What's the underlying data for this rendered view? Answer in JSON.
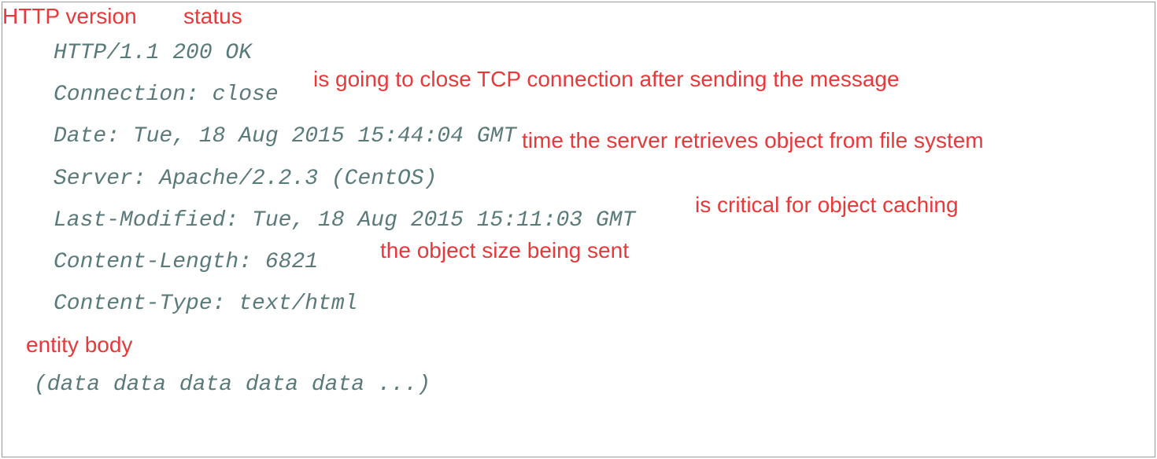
{
  "http": {
    "statusLine": "HTTP/1.1 200 OK",
    "connection": "Connection: close",
    "date": "Date: Tue, 18 Aug 2015 15:44:04 GMT",
    "server": "Server: Apache/2.2.3 (CentOS)",
    "lastModified": "Last-Modified: Tue, 18 Aug 2015 15:11:03 GMT",
    "contentLength": "Content-Length: 6821",
    "contentType": "Content-Type: text/html",
    "body": "(data data data data data ...)"
  },
  "annotations": {
    "httpVersion": "HTTP version",
    "status": "status",
    "connection": "is going to close TCP connection after sending the message",
    "date": "time the server retrieves object from file system",
    "lastModified": "is critical for object caching",
    "contentLength": "the object size being sent",
    "entityBody": "entity body"
  }
}
